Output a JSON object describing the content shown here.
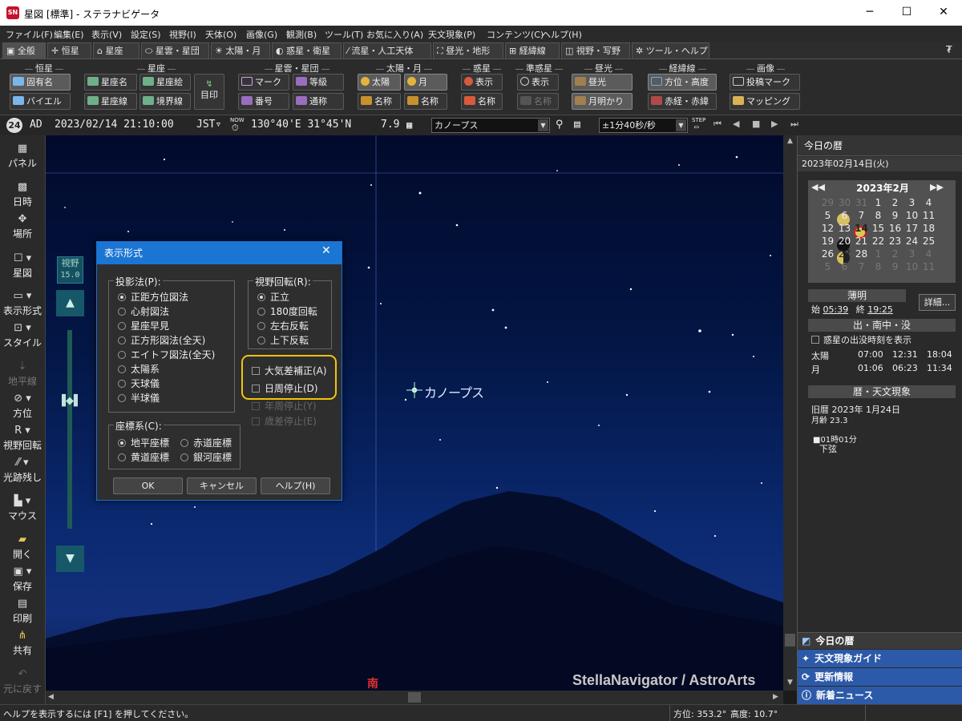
{
  "window": {
    "title": "星図 [標準] - ステラナビゲータ",
    "app_icon": "SN"
  },
  "menu": [
    "ファイル(F)",
    "編集(E)",
    "表示(V)",
    "設定(S)",
    "視野(I)",
    "天体(O)",
    "画像(G)",
    "観測(B)",
    "ツール(T)",
    "お気に入り(A)",
    "天文現象(P)",
    "コンテンツ(C)",
    "ヘルプ(H)"
  ],
  "tabs": [
    "全般",
    "恒星",
    "星座",
    "星雲・星団",
    "太陽・月",
    "惑星・衛星",
    "流星・人工天体",
    "昼光・地形",
    "経緯線",
    "視野・写野",
    "ツール・ヘルプ"
  ],
  "ribbon": {
    "groups": [
      "恒星",
      "星座",
      "星雲・星団",
      "太陽・月",
      "惑星",
      "準惑星",
      "昼光",
      "経緯線",
      "画像"
    ],
    "buttons": {
      "fixed_name": "固有名",
      "bayer": "バイエル",
      "const_name": "星座名",
      "const_line": "星座線",
      "const_pic": "星座絵",
      "boundary": "境界線",
      "mark_btn": "目印",
      "neb_mark": "マーク",
      "neb_grade": "等級",
      "neb_number": "番号",
      "neb_common": "通称",
      "sun": "太陽",
      "moon": "月",
      "sm_name1": "名称",
      "sm_name2": "名称",
      "planet_show": "表示",
      "planet_name": "名称",
      "dwarf_show": "表示",
      "dwarf_name": "名称",
      "daylight": "昼光",
      "moonlight": "月明かり",
      "azalt": "方位・高度",
      "radec": "赤経・赤緯",
      "posted_mark": "投稿マーク",
      "mapping": "マッピング"
    }
  },
  "infobar": {
    "date_badge": "24",
    "era": "AD",
    "datetime": "2023/02/14 21:10:00",
    "tz": "JST▿",
    "now": "NOW",
    "location": "130°40'E 31°45'N",
    "limit_mag": "7.9",
    "target": "カノープス",
    "step": "±1分40秒/秒",
    "step_label": "STEP"
  },
  "leftbar": [
    "パネル",
    "日時",
    "場所",
    "星図",
    "表示形式",
    "スタイル",
    "地平線",
    "方位",
    "視野回転",
    "光跡残し",
    "マウス",
    "開く",
    "保存",
    "印刷",
    "共有",
    "元に戻す"
  ],
  "fov": {
    "label": "視野",
    "value": "15.0"
  },
  "sky": {
    "star_label": "カノープス",
    "compass": "南",
    "watermark": "StellaNavigator / AstroArts"
  },
  "dialog": {
    "title": "表示形式",
    "projection": {
      "legend": "投影法(P):",
      "options": [
        "正距方位図法",
        "心射図法",
        "星座早見",
        "正方形図法(全天)",
        "エイトフ図法(全天)",
        "太陽系",
        "天球儀",
        "半球儀"
      ],
      "selected": 0
    },
    "rotation": {
      "legend": "視野回転(R):",
      "options": [
        "正立",
        "180度回転",
        "左右反転",
        "上下反転"
      ],
      "selected": 0
    },
    "checks": [
      "大気差補正(A)",
      "日周停止(D)"
    ],
    "disabled_checks": [
      "年周停止(Y)",
      "歳差停止(E)"
    ],
    "coords": {
      "legend": "座標系(C):",
      "options": [
        "地平座標",
        "赤道座標",
        "黄道座標",
        "銀河座標"
      ],
      "selected": 0
    },
    "buttons": [
      "OK",
      "キャンセル",
      "ヘルプ(H)"
    ]
  },
  "right": {
    "title": "今日の暦",
    "date": "2023年02月14日(火)",
    "month": "2023年2月",
    "calendar": [
      [
        "29",
        "30",
        "31",
        "1",
        "2",
        "3",
        "4"
      ],
      [
        "5",
        "6",
        "7",
        "8",
        "9",
        "10",
        "11"
      ],
      [
        "12",
        "13",
        "14",
        "15",
        "16",
        "17",
        "18"
      ],
      [
        "19",
        "20",
        "21",
        "22",
        "23",
        "24",
        "25"
      ],
      [
        "26",
        "27",
        "28",
        "1",
        "2",
        "3",
        "4"
      ],
      [
        "5",
        "6",
        "7",
        "8",
        "9",
        "10",
        "11"
      ]
    ],
    "twilight": {
      "head": "薄明",
      "start_label": "始",
      "start": "05:39",
      "end_label": "終",
      "end": "19:25",
      "detail": "詳細..."
    },
    "rise": {
      "head": "出・南中・没",
      "check": "惑星の出没時刻を表示",
      "sun": [
        "太陽",
        "07:00",
        "12:31",
        "18:04"
      ],
      "moon": [
        "月",
        "01:06",
        "06:23",
        "11:34"
      ]
    },
    "almanac": {
      "head": "暦・天文現象",
      "lunar": "旧暦 2023年 1月24日",
      "age": "月齢 23.3",
      "event_time": "■01時01分",
      "event": "下弦"
    },
    "guides": [
      "今日の暦",
      "天文現象ガイド",
      "更新情報",
      "新着ニュース"
    ]
  },
  "status": {
    "help": "ヘルプを表示するには [F1] を押してください。",
    "az": "方位: 353.2°",
    "alt": "高度: 10.7°"
  }
}
